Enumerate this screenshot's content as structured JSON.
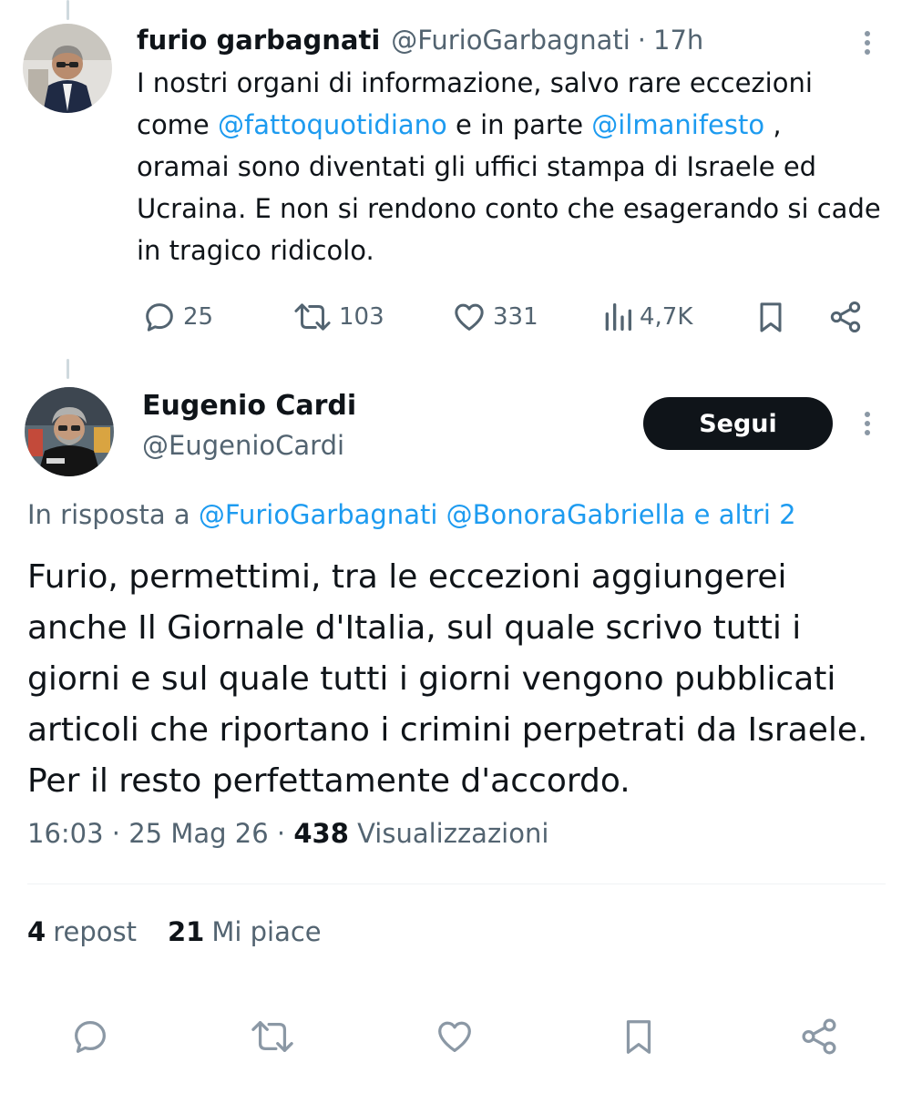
{
  "parent_tweet": {
    "name": "furio garbagnati",
    "handle": "@FurioGarbagnati",
    "separator": "·",
    "time": "17h",
    "text_line1": "I nostri organi di informazione, salvo rare eccezioni",
    "text_come": "come ",
    "mention1": "@fattoquotidiano",
    "text_inparte": " e in parte ",
    "mention2": "@ilmanifesto",
    "text_after": " ,",
    "text_rest": "oramai sono diventati gli uffici stampa di Israele ed Ucraina. E non si rendono conto che esagerando si cade in tragico ridicolo.",
    "actions": {
      "replies": "25",
      "reposts": "103",
      "likes": "331",
      "views": "4,7K"
    }
  },
  "reply_tweet": {
    "name": "Eugenio Cardi",
    "handle": "@EugenioCardi",
    "follow_label": "Segui",
    "reply_prefix": "In risposta a ",
    "reply_mention1": "@FurioGarbagnati",
    "reply_mention2": "@BonoraGabriella",
    "reply_others": "e altri 2",
    "text": "Furio, permettimi, tra le eccezioni aggiungerei anche Il Giornale d'Italia, sul quale scrivo tutti i giorni e sul quale tutti i giorni vengono pubblicati articoli che riportano i crimini perpetrati da Israele. Per il resto perfettamente d'accordo.",
    "time": "16:03",
    "date": "25 Mag 26",
    "sep": "·",
    "views_count": "438",
    "views_label": "Visualizzazioni",
    "reposts_count": "4",
    "reposts_label": "repost",
    "likes_count": "21",
    "likes_label": "Mi piace"
  },
  "colors": {
    "text": "#0f1419",
    "secondary": "#536471",
    "link": "#1d9bf0",
    "icon": "#536471",
    "bottom_icon": "#8b98a5",
    "divider": "#eff3f4"
  },
  "icons": {
    "reply": "speech-bubble-icon",
    "repost": "repost-arrows-icon",
    "like": "heart-icon",
    "views": "bar-chart-icon",
    "bookmark": "bookmark-icon",
    "share": "share-icon",
    "more": "more-vertical-icon"
  }
}
